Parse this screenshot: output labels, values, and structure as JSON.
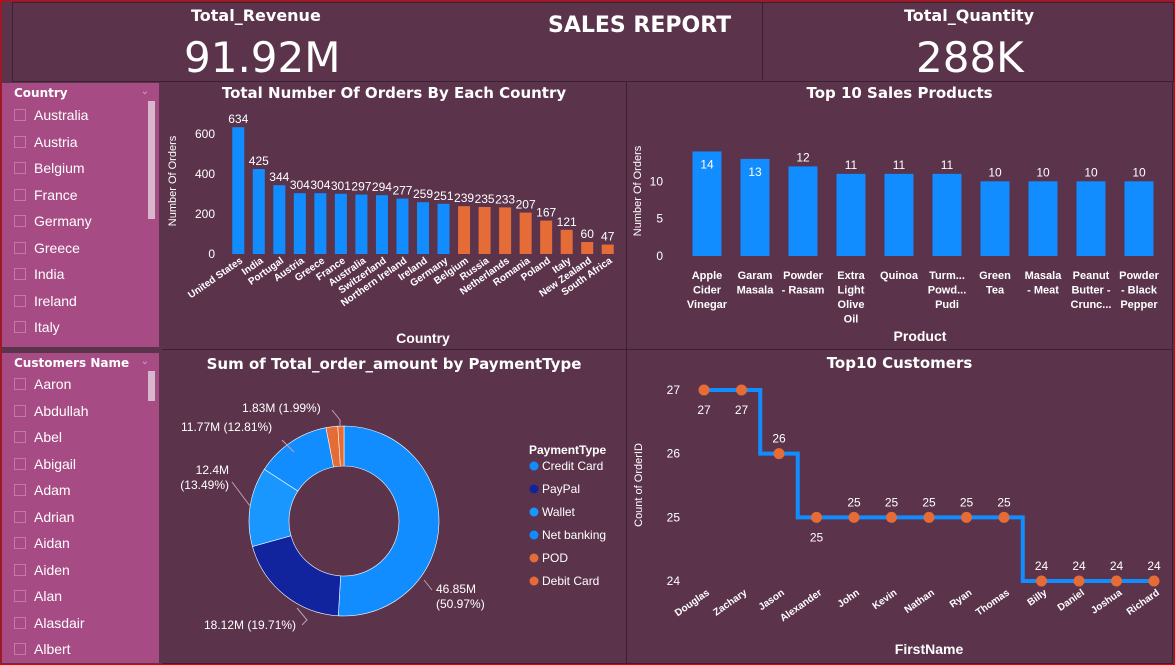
{
  "header": {
    "revenue_title": "Total_Revenue",
    "revenue_value": "91.92M",
    "report_title": "SALES REPORT",
    "quantity_title": "Total_Quantity",
    "quantity_value": "288K"
  },
  "country_slicer": {
    "title": "Country",
    "items": [
      "Australia",
      "Austria",
      "Belgium",
      "France",
      "Germany",
      "Greece",
      "India",
      "Ireland",
      "Italy"
    ]
  },
  "customer_slicer": {
    "title": "Customers Name",
    "items": [
      "Aaron",
      "Abdullah",
      "Abel",
      "Abigail",
      "Adam",
      "Adrian",
      "Aidan",
      "Aiden",
      "Alan",
      "Alasdair",
      "Albert"
    ]
  },
  "colors": {
    "blue": "#118dff",
    "orange": "#e66c37",
    "navy": "#12239e",
    "light_blue": "#1a97ff",
    "slicer_bg": "#a74b85",
    "bg": "#5b344c"
  },
  "orders_chart": {
    "title": "Total Number Of Orders By Each Country",
    "xlabel": "Country",
    "ylabel": "Number Of Orders",
    "yticks": [
      "0",
      "200",
      "400",
      "600"
    ],
    "chart_data": {
      "type": "bar",
      "ylim": [
        0,
        700
      ],
      "categories": [
        "United States",
        "India",
        "Portugal",
        "Austria",
        "Greece",
        "France",
        "Australia",
        "Switzerland",
        "Northern Ireland",
        "Ireland",
        "Germany",
        "Belgium",
        "Russia",
        "Netherlands",
        "Romania",
        "Poland",
        "Italy",
        "New Zealand",
        "South Africa"
      ],
      "values": [
        634,
        425,
        344,
        304,
        304,
        301,
        297,
        294,
        277,
        259,
        251,
        239,
        235,
        233,
        207,
        167,
        121,
        60,
        47
      ],
      "bar_colors": [
        "blue",
        "blue",
        "blue",
        "blue",
        "blue",
        "blue",
        "blue",
        "blue",
        "blue",
        "blue",
        "blue",
        "orange",
        "orange",
        "orange",
        "orange",
        "orange",
        "orange",
        "orange",
        "orange"
      ]
    }
  },
  "products_chart": {
    "title": "Top 10 Sales Products",
    "xlabel": "Product",
    "ylabel": "Number Of Orders",
    "yticks": [
      "0",
      "5",
      "10"
    ],
    "chart_data": {
      "type": "bar",
      "ylim": [
        0,
        15
      ],
      "categories": [
        [
          "Apple",
          "Cider",
          "Vinegar"
        ],
        [
          "Garam",
          "Masala"
        ],
        [
          "Powder",
          "- Rasam"
        ],
        [
          "Extra",
          "Light",
          "Olive",
          "Oil"
        ],
        [
          "Quinoa"
        ],
        [
          "Turm...",
          "Powd...",
          "Pudi"
        ],
        [
          "Green",
          "Tea"
        ],
        [
          "Masala",
          "- Meat"
        ],
        [
          "Peanut",
          "Butter -",
          "Crunc..."
        ],
        [
          "Powder",
          "- Black",
          "Pepper"
        ]
      ],
      "values": [
        14,
        13,
        12,
        11,
        11,
        11,
        10,
        10,
        10,
        10
      ]
    }
  },
  "payment_chart": {
    "title": "Sum of Total_order_amount by PaymentType",
    "legend_title": "PaymentType",
    "chart_data": {
      "type": "pie",
      "series": [
        {
          "name": "Credit Card",
          "value": 46.85,
          "label": [
            "46.85M",
            "(50.97%)"
          ],
          "color": "#118dff"
        },
        {
          "name": "PayPal",
          "value": 18.12,
          "label": [
            "18.12M (19.71%)"
          ],
          "color": "#12239e"
        },
        {
          "name": "Wallet",
          "value": 12.4,
          "label": [
            "12.4M",
            "(13.49%)"
          ],
          "color": "#1a97ff"
        },
        {
          "name": "Net banking",
          "value": 11.77,
          "label": [
            "11.77M (12.81%)"
          ],
          "color": "#118dff"
        },
        {
          "name": "POD",
          "value": 1.83,
          "label": [
            "1.83M (1.99%)"
          ],
          "color": "#e66c37"
        },
        {
          "name": "Debit Card",
          "value": 0.96,
          "label": [],
          "color": "#e66c37"
        }
      ]
    }
  },
  "customers_chart": {
    "title": "Top10 Customers",
    "xlabel": "FirstName",
    "ylabel": "Count of OrderID",
    "yticks": [
      "24",
      "25",
      "26",
      "27"
    ],
    "chart_data": {
      "type": "line",
      "ylim": [
        24,
        27
      ],
      "categories": [
        "Douglas",
        "Zachary",
        "Jason",
        "Alexander",
        "John",
        "Kevin",
        "Nathan",
        "Ryan",
        "Thomas",
        "Billy",
        "Daniel",
        "Joshua",
        "Richard"
      ],
      "values": [
        27,
        27,
        26,
        25,
        25,
        25,
        25,
        25,
        25,
        24,
        24,
        24,
        24
      ]
    }
  }
}
